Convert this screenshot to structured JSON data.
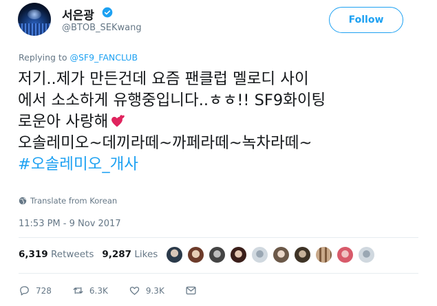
{
  "user": {
    "display_name": "서은광",
    "handle": "@BTOB_SEKwang",
    "verified_icon": "verified-badge-icon"
  },
  "follow_label": "Follow",
  "reply": {
    "prefix": "Replying to",
    "mention": "@SF9_FANCLUB"
  },
  "tweet": {
    "line1": "저기..제가 만든건데 요즘 팬클럽 멜로디 사이",
    "line2": "에서 소소하게 유행중입니다..ㅎㅎ!! SF9화이팅",
    "line3": "로운아 사랑해",
    "line4": "오솔레미오~데끼라떼~까페라떼~녹차라떼~",
    "hashtag": "#오솔레미오_개사",
    "emoji": "two-hearts-icon"
  },
  "translate_label": "Translate from Korean",
  "timestamp": "11:53 PM - 9 Nov 2017",
  "stats": {
    "retweets_count": "6,319",
    "retweets_label": "Retweets",
    "likes_count": "9,287",
    "likes_label": "Likes"
  },
  "actions": {
    "reply_count": "728",
    "retweet_count": "6.3K",
    "like_count": "9.3K"
  },
  "colors": {
    "accent": "#1da1f2",
    "muted": "#657786",
    "heart": "#e0245e"
  }
}
